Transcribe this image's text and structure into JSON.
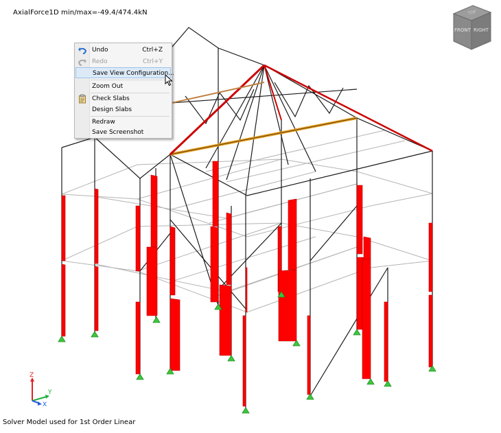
{
  "viewport": {
    "result_label": "AxialForce1D min/max=-49.4/474.4kN",
    "status": "Solver Model used for 1st Order Linear"
  },
  "view_cube": {
    "top": "TOP",
    "front": "FRONT",
    "right": "RIGHT"
  },
  "axis_triad": {
    "z": "Z",
    "y": "Y",
    "x": "X"
  },
  "context_menu": {
    "items": [
      {
        "label": "Undo",
        "shortcut": "Ctrl+Z",
        "icon": "undo-icon",
        "enabled": true
      },
      {
        "label": "Redo",
        "shortcut": "Ctrl+Y",
        "icon": "redo-icon",
        "enabled": false
      },
      {
        "label": "Save View Configuration...",
        "shortcut": "",
        "icon": "",
        "enabled": true,
        "hovered": true
      },
      {
        "label": "Zoom Out",
        "shortcut": "",
        "icon": "",
        "enabled": true
      },
      {
        "label": "Check Slabs",
        "shortcut": "",
        "icon": "clipboard-icon",
        "enabled": true
      },
      {
        "label": "Design Slabs",
        "shortcut": "",
        "icon": "",
        "enabled": true
      },
      {
        "label": "Redraw",
        "shortcut": "",
        "icon": "",
        "enabled": true
      },
      {
        "label": "Save Screenshot",
        "shortcut": "",
        "icon": "",
        "enabled": true
      }
    ]
  },
  "colors": {
    "force_diagram": "#ff0000",
    "highlight_member": "#e8a020",
    "frame_line": "#000000",
    "slab_grid": "#b4b4b4",
    "support": "#3cc83c",
    "axis_x": "#2060e0",
    "axis_y": "#20b040",
    "axis_z": "#e02020"
  }
}
